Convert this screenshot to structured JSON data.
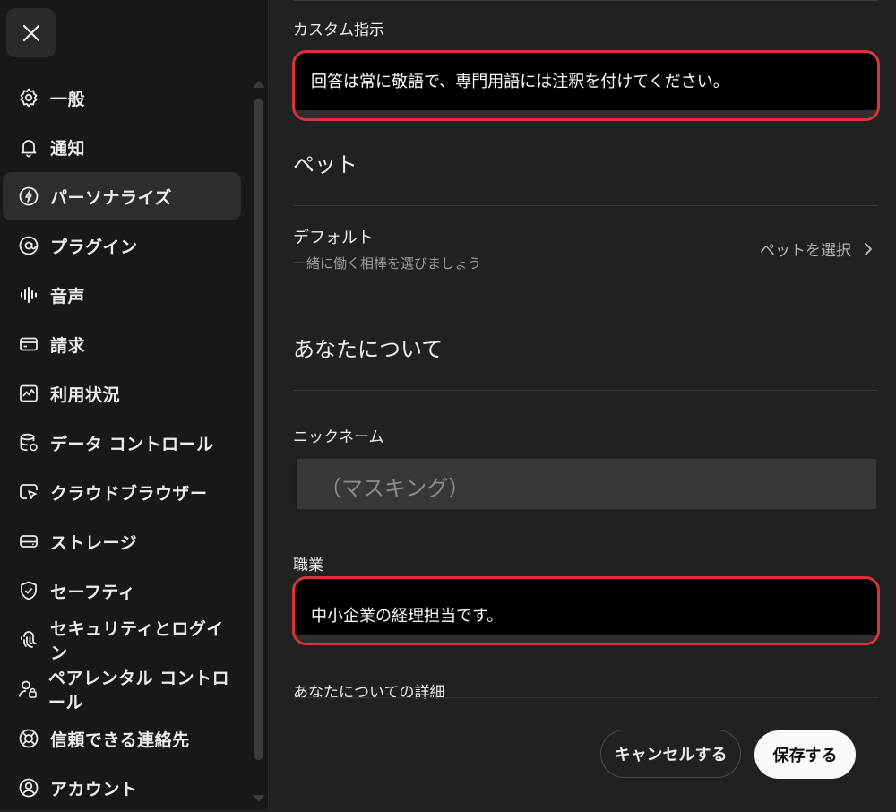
{
  "sidebar": {
    "close_icon": "close-icon",
    "items": [
      {
        "label": "一般",
        "icon": "gear-icon"
      },
      {
        "label": "通知",
        "icon": "bell-icon"
      },
      {
        "label": "パーソナライズ",
        "icon": "personalize-icon",
        "active": true
      },
      {
        "label": "プラグイン",
        "icon": "at-icon"
      },
      {
        "label": "音声",
        "icon": "waveform-icon"
      },
      {
        "label": "請求",
        "icon": "card-icon"
      },
      {
        "label": "利用状況",
        "icon": "chart-icon"
      },
      {
        "label": "データ コントロール",
        "icon": "database-icon"
      },
      {
        "label": "クラウドブラウザー",
        "icon": "cloud-browser-icon"
      },
      {
        "label": "ストレージ",
        "icon": "storage-icon"
      },
      {
        "label": "セーフティ",
        "icon": "shield-icon"
      },
      {
        "label": "セキュリティとログイン",
        "icon": "fingerprint-icon"
      },
      {
        "label": "ペアレンタル コントロール",
        "icon": "parental-icon"
      },
      {
        "label": "信頼できる連絡先",
        "icon": "lifebuoy-icon"
      },
      {
        "label": "アカウント",
        "icon": "user-circle-icon"
      }
    ]
  },
  "main": {
    "custom_instructions_label": "カスタム指示",
    "custom_instructions_value": "回答は常に敬語で、専門用語には注釈を付けてください。",
    "pet_heading": "ペット",
    "pet_row": {
      "title": "デフォルト",
      "subtitle": "一緒に働く相棒を選びましょう",
      "action": "ペットを選択"
    },
    "about_heading": "あなたについて",
    "nickname_label": "ニックネーム",
    "nickname_value": "（マスキング）",
    "occupation_label": "職業",
    "occupation_value": "中小企業の経理担当です。",
    "more_about_label": "あなたについての詳細"
  },
  "footer": {
    "cancel_label": "キャンセルする",
    "save_label": "保存する"
  },
  "colors": {
    "highlight": "#d8343c",
    "background": "#212121",
    "sidebar": "#181818"
  }
}
